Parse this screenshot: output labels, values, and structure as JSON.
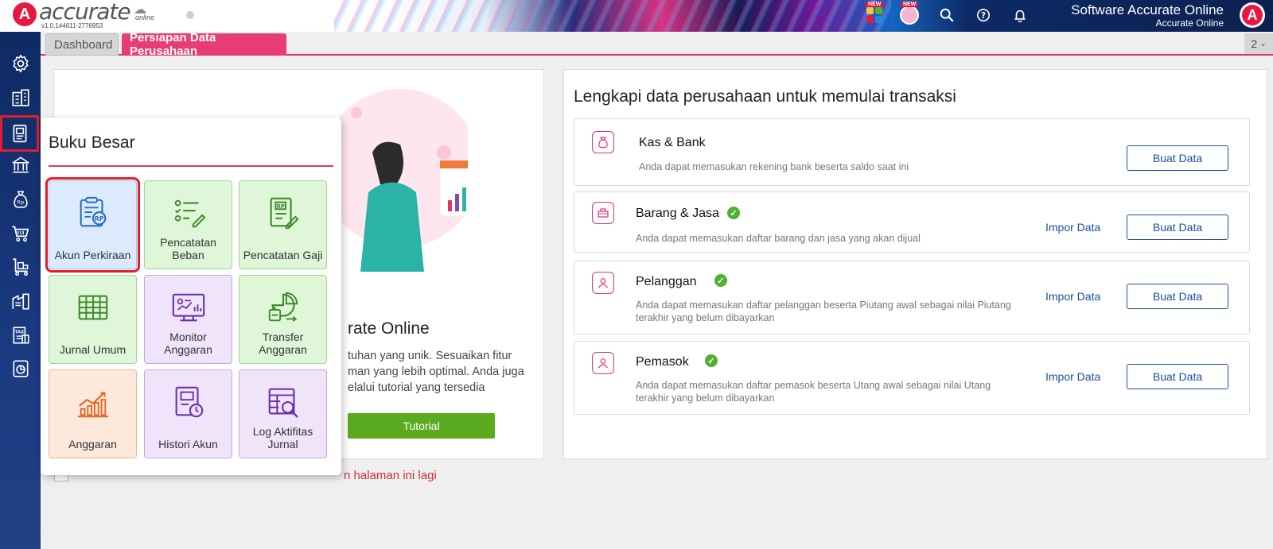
{
  "header": {
    "logo_text": "accurate",
    "logo_online": "online",
    "version": "v1.0.1#4611-2776953",
    "new_badge_1": "NEW",
    "new_badge_2": "NEW",
    "title": "Software Accurate Online",
    "subtitle": "Accurate Online",
    "logo_letter": "A"
  },
  "tabs": [
    {
      "label": "Dashboard"
    },
    {
      "label": "Persiapan Data Perusahaan"
    }
  ],
  "tab_count": "2",
  "welcome": {
    "title": "rate Online",
    "desc_line1": "tuhan yang unik. Sesuaikan fitur",
    "desc_line2": "man yang lebih optimal. Anda juga",
    "desc_line3": "elalui tutorial yang tersedia",
    "tutorial_label": "Tutorial",
    "dont_show_text": "n halaman ini lagi"
  },
  "setup": {
    "title": "Lengkapi data perusahaan untuk memulai transaksi",
    "rows": [
      {
        "name": "Kas & Bank",
        "desc": "Anda dapat memasukan rekening bank beserta saldo saat ini",
        "desc2": "",
        "impor": "",
        "buat": "Buat Data"
      },
      {
        "name": "Barang & Jasa",
        "desc": "Anda dapat memasukan daftar barang dan jasa yang akan dijual",
        "desc2": "",
        "impor": "Impor Data",
        "buat": "Buat Data"
      },
      {
        "name": "Pelanggan",
        "desc": "Anda dapat memasukan daftar pelanggan beserta Piutang awal sebagai nilai Piutang",
        "desc2": "terakhir yang belum dibayarkan",
        "impor": "Impor Data",
        "buat": "Buat Data"
      },
      {
        "name": "Pemasok",
        "desc": "Anda dapat memasukan daftar pemasok beserta Utang awal sebagai nilai Utang",
        "desc2": "terakhir yang belum dibayarkan",
        "impor": "Impor Data",
        "buat": "Buat Data"
      }
    ]
  },
  "popup": {
    "title": "Buku Besar",
    "tiles": [
      {
        "line1": "Akun Perkiraan",
        "line2": "",
        "icon": "account-chart-icon"
      },
      {
        "line1": "Pencatatan",
        "line2": "Beban",
        "icon": "expense-list-icon"
      },
      {
        "line1": "Pencatatan Gaji",
        "line2": "",
        "icon": "payroll-icon"
      },
      {
        "line1": "Jurnal Umum",
        "line2": "",
        "icon": "journal-grid-icon"
      },
      {
        "line1": "Monitor",
        "line2": "Anggaran",
        "icon": "monitor-budget-icon"
      },
      {
        "line1": "Transfer",
        "line2": "Anggaran",
        "icon": "transfer-budget-icon"
      },
      {
        "line1": "Anggaran",
        "line2": "",
        "icon": "budget-chart-icon"
      },
      {
        "line1": "Histori Akun",
        "line2": "",
        "icon": "account-history-icon"
      },
      {
        "line1": "Log Aktifitas",
        "line2": "Jurnal",
        "icon": "journal-log-icon"
      }
    ]
  },
  "colors": {
    "accent_pink": "#e2336f",
    "brand_red": "#e8173f",
    "sidebar_navy": "#1a3a80",
    "link_blue": "#1a4fa0",
    "success_green": "#4fb233",
    "tutorial_green": "#5aab1f"
  }
}
